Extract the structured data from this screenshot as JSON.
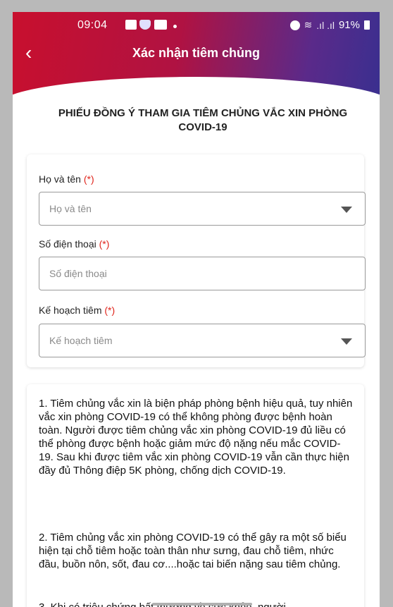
{
  "status_bar": {
    "time": "09:04",
    "battery": "91%",
    "icons": [
      "image-icon",
      "shield-icon",
      "zalo-icon",
      "alarm-icon",
      "wifi-icon",
      "signal-icon",
      "battery-icon"
    ]
  },
  "header": {
    "back_icon": "‹",
    "title": "Xác nhận tiêm chủng"
  },
  "form": {
    "title": "PHIẾU ĐỒNG Ý THAM GIA TIÊM CHỦNG VẮC XIN PHÒNG COVID-19",
    "required_mark": "(*)",
    "fields": [
      {
        "label": "Họ và tên",
        "placeholder": "Họ và tên",
        "type": "dropdown"
      },
      {
        "label": "Số điện thoại",
        "placeholder": "Số điện thoại",
        "type": "text"
      },
      {
        "label": "Kế hoạch tiêm",
        "placeholder": "Kế hoạch tiêm",
        "type": "dropdown"
      }
    ]
  },
  "info": {
    "paragraphs": [
      "1. Tiêm chủng vắc xin là biện pháp phòng bệnh hiệu quả, tuy nhiên vắc xin phòng COVID-19 có thể không phòng được bệnh hoàn toàn. Người được tiêm chủng vắc xin phòng COVID-19 đủ liều có thể phòng được bệnh hoặc giảm mức độ nặng nếu mắc COVID-19. Sau khi được tiêm vắc xin phòng COVID-19 vẫn cần thực hiện đầy đủ Thông điệp 5K phòng, chống dịch COVID-19.",
      "2. Tiêm chủng vắc xin phòng COVID-19 có thể gây ra một số biểu hiện tại chỗ tiêm hoặc toàn thân như sưng, đau chỗ tiêm, nhức đầu, buồn nôn, sốt, đau cơ....hoặc tai biến nặng sau tiêm chủng.",
      "3. Khi có triệu chứng bất thường về sức khỏe, người"
    ]
  },
  "colors": {
    "header_start": "#c8102e",
    "header_end": "#3a2f8f",
    "required": "#e0241b"
  }
}
